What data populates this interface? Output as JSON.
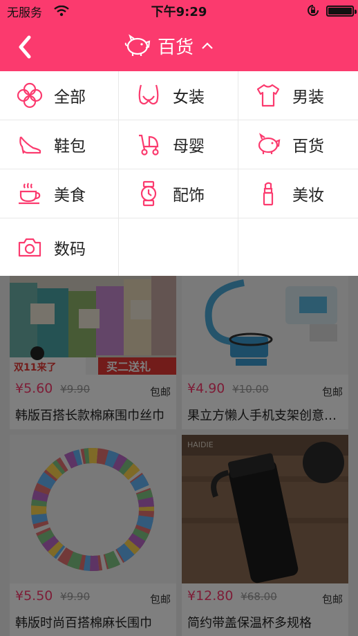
{
  "status_bar": {
    "carrier": "无服务",
    "time": "下午9:29"
  },
  "nav": {
    "title": "百货",
    "icons": {
      "back": "back-chevron-icon",
      "title": "piggy-bank-icon",
      "caret": "chevron-up-icon"
    }
  },
  "categories": [
    {
      "label": "全部",
      "icon": "all-icon"
    },
    {
      "label": "女装",
      "icon": "womenswear-icon"
    },
    {
      "label": "男装",
      "icon": "menswear-icon"
    },
    {
      "label": "鞋包",
      "icon": "shoe-icon"
    },
    {
      "label": "母婴",
      "icon": "stroller-icon"
    },
    {
      "label": "百货",
      "icon": "piggy-bank-icon"
    },
    {
      "label": "美食",
      "icon": "coffee-cup-icon"
    },
    {
      "label": "配饰",
      "icon": "watch-icon"
    },
    {
      "label": "美妆",
      "icon": "lipstick-icon"
    },
    {
      "label": "数码",
      "icon": "camera-icon"
    }
  ],
  "products": [
    {
      "price": "¥5.60",
      "original_price": "¥9.90",
      "shipping": "包邮",
      "name": "韩版百搭长款棉麻围巾丝巾",
      "image_text": [
        "双11来了",
        "买二送礼"
      ]
    },
    {
      "price": "¥4.90",
      "original_price": "¥10.00",
      "shipping": "包邮",
      "name": "果立方懒人手机支架创意…"
    },
    {
      "price": "¥5.50",
      "original_price": "¥9.90",
      "shipping": "包邮",
      "name": "韩版时尚百搭棉麻长围巾"
    },
    {
      "price": "¥12.80",
      "original_price": "¥68.00",
      "shipping": "包邮",
      "name": "简约带盖保温杯多规格",
      "image_text": [
        "HAIDIE"
      ]
    }
  ],
  "colors": {
    "accent": "#fb3a6e",
    "overlay": "rgba(0,0,0,0.5)"
  }
}
